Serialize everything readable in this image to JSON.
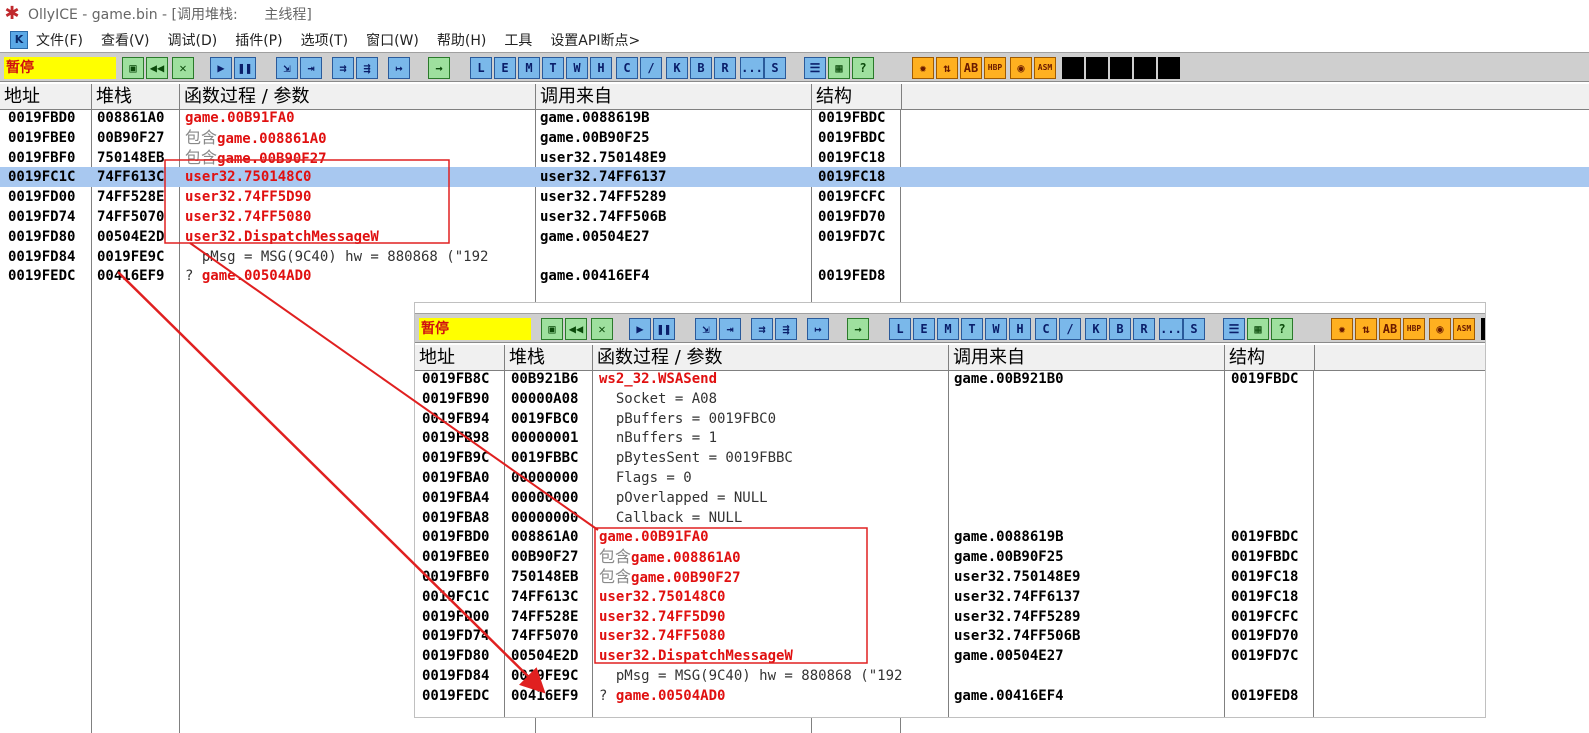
{
  "title": "OllyICE - game.bin - [调用堆栈:      主线程]",
  "menu": [
    "文件(F)",
    "查看(V)",
    "调试(D)",
    "插件(P)",
    "选项(T)",
    "窗口(W)",
    "帮助(H)",
    "工具",
    "设置API断点>"
  ],
  "status": "暂停",
  "columns": [
    "地址",
    "堆栈",
    "函数过程 / 参数",
    "调用来自",
    "结构"
  ],
  "tb_letters": [
    "L",
    "E",
    "M",
    "T",
    "W",
    "H",
    "C",
    "/",
    "K",
    "B",
    "R",
    "...",
    "S"
  ],
  "rows": [
    {
      "addr": "0019FBD0",
      "stack": "008861A0",
      "p": "",
      "f": "game.00B91FA0",
      "type": "red",
      "from": "game.0088619B",
      "frame": "0019FBDC"
    },
    {
      "addr": "0019FBE0",
      "stack": "00B90F27",
      "p": "包含",
      "f": "game.008861A0",
      "type": "contain",
      "from": "game.00B90F25",
      "frame": "0019FBDC"
    },
    {
      "addr": "0019FBF0",
      "stack": "750148EB",
      "p": "包含",
      "f": "game.00B90F27",
      "type": "contain",
      "from": "user32.750148E9",
      "frame": "0019FC18"
    },
    {
      "addr": "0019FC1C",
      "stack": "74FF613C",
      "p": "",
      "f": "user32.750148C0",
      "type": "red",
      "from": "user32.74FF6137",
      "frame": "0019FC18",
      "sel": true
    },
    {
      "addr": "0019FD00",
      "stack": "74FF528E",
      "p": "",
      "f": "user32.74FF5D90",
      "type": "red",
      "from": "user32.74FF5289",
      "frame": "0019FCFC"
    },
    {
      "addr": "0019FD74",
      "stack": "74FF5070",
      "p": "",
      "f": "user32.74FF5080",
      "type": "red",
      "from": "user32.74FF506B",
      "frame": "0019FD70"
    },
    {
      "addr": "0019FD80",
      "stack": "00504E2D",
      "p": "",
      "f": "user32.DispatchMessageW",
      "type": "red",
      "from": "game.00504E27",
      "frame": "0019FD7C"
    },
    {
      "addr": "0019FD84",
      "stack": "0019FE9C",
      "p": "",
      "f": "  pMsg = MSG(9C40) hw = 880868 (\"192",
      "type": "arg",
      "from": "",
      "frame": ""
    },
    {
      "addr": "0019FEDC",
      "stack": "00416EF9",
      "p": "? ",
      "f": "game.00504AD0",
      "type": "q",
      "from": "game.00416EF4",
      "frame": "0019FED8"
    }
  ],
  "sub_rows": [
    {
      "addr": "0019FB8C",
      "stack": "00B921B6",
      "p": "",
      "f": "ws2_32.WSASend",
      "type": "red",
      "from": "game.00B921B0",
      "frame": "0019FBDC"
    },
    {
      "addr": "0019FB90",
      "stack": "00000A08",
      "p": "",
      "f": "  Socket = A08",
      "type": "arg",
      "from": "",
      "frame": ""
    },
    {
      "addr": "0019FB94",
      "stack": "0019FBC0",
      "p": "",
      "f": "  pBuffers = 0019FBC0",
      "type": "arg",
      "from": "",
      "frame": ""
    },
    {
      "addr": "0019FB98",
      "stack": "00000001",
      "p": "",
      "f": "  nBuffers = 1",
      "type": "arg",
      "from": "",
      "frame": ""
    },
    {
      "addr": "0019FB9C",
      "stack": "0019FBBC",
      "p": "",
      "f": "  pBytesSent = 0019FBBC",
      "type": "arg",
      "from": "",
      "frame": ""
    },
    {
      "addr": "0019FBA0",
      "stack": "00000000",
      "p": "",
      "f": "  Flags = 0",
      "type": "arg",
      "from": "",
      "frame": ""
    },
    {
      "addr": "0019FBA4",
      "stack": "00000000",
      "p": "",
      "f": "  pOverlapped = NULL",
      "type": "arg",
      "from": "",
      "frame": ""
    },
    {
      "addr": "0019FBA8",
      "stack": "00000000",
      "p": "",
      "f": "  Callback = NULL",
      "type": "arg",
      "from": "",
      "frame": ""
    },
    {
      "addr": "0019FBD0",
      "stack": "008861A0",
      "p": "",
      "f": "game.00B91FA0",
      "type": "red",
      "from": "game.0088619B",
      "frame": "0019FBDC"
    },
    {
      "addr": "0019FBE0",
      "stack": "00B90F27",
      "p": "包含",
      "f": "game.008861A0",
      "type": "contain",
      "from": "game.00B90F25",
      "frame": "0019FBDC"
    },
    {
      "addr": "0019FBF0",
      "stack": "750148EB",
      "p": "包含",
      "f": "game.00B90F27",
      "type": "contain",
      "from": "user32.750148E9",
      "frame": "0019FC18"
    },
    {
      "addr": "0019FC1C",
      "stack": "74FF613C",
      "p": "",
      "f": "user32.750148C0",
      "type": "red",
      "from": "user32.74FF6137",
      "frame": "0019FC18"
    },
    {
      "addr": "0019FD00",
      "stack": "74FF528E",
      "p": "",
      "f": "user32.74FF5D90",
      "type": "red",
      "from": "user32.74FF5289",
      "frame": "0019FCFC"
    },
    {
      "addr": "0019FD74",
      "stack": "74FF5070",
      "p": "",
      "f": "user32.74FF5080",
      "type": "red",
      "from": "user32.74FF506B",
      "frame": "0019FD70"
    },
    {
      "addr": "0019FD80",
      "stack": "00504E2D",
      "p": "",
      "f": "user32.DispatchMessageW",
      "type": "red",
      "from": "game.00504E27",
      "frame": "0019FD7C"
    },
    {
      "addr": "0019FD84",
      "stack": "0019FE9C",
      "p": "",
      "f": "  pMsg = MSG(9C40) hw = 880868 (\"192",
      "type": "arg",
      "from": "",
      "frame": ""
    },
    {
      "addr": "0019FEDC",
      "stack": "00416EF9",
      "p": "? ",
      "f": "game.00504AD0",
      "type": "q",
      "from": "game.00416EF4",
      "frame": "0019FED8"
    }
  ],
  "colors": {
    "selection": "#a8c8f0",
    "function_red": "#e01010",
    "annotation_red": "#e02020",
    "status_bg": "#ffff00"
  }
}
